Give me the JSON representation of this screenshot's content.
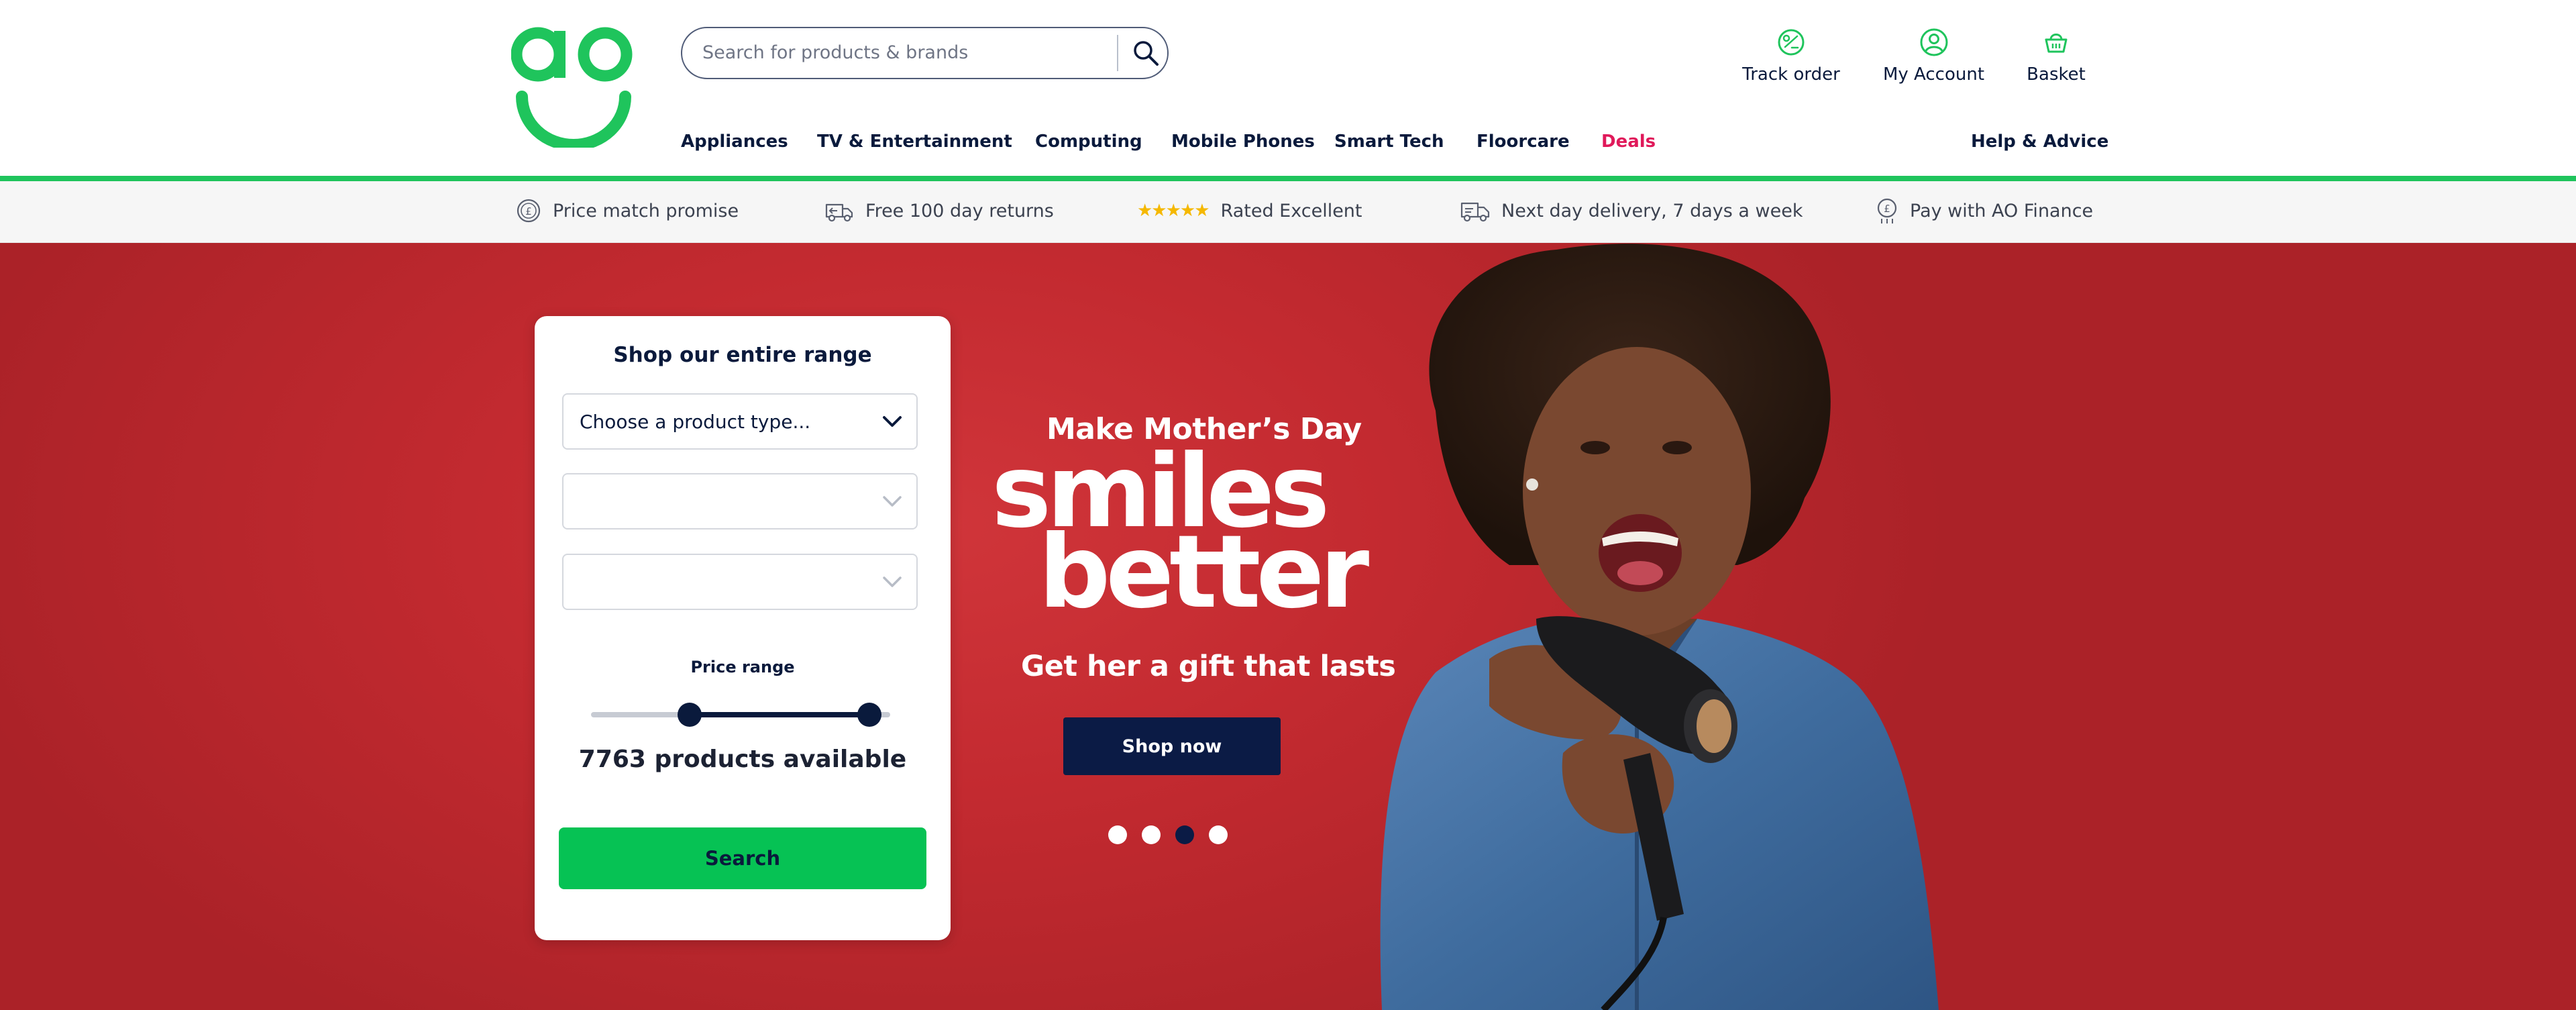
{
  "colors": {
    "brand_green": "#1fc45c",
    "navy": "#0a1a3c",
    "deals_pink": "#e0195a",
    "hero_red": "#c32a30",
    "search_button_green": "#06c254"
  },
  "header": {
    "search": {
      "placeholder": "Search for products & brands",
      "icon": "search-icon"
    },
    "utility": [
      {
        "label": "Track order",
        "icon": "track-order-icon"
      },
      {
        "label": "My Account",
        "icon": "account-icon"
      },
      {
        "label": "Basket",
        "icon": "basket-icon"
      }
    ],
    "nav": [
      "Appliances",
      "TV & Entertainment",
      "Computing",
      "Mobile Phones",
      "Smart Tech",
      "Floorcare",
      "Deals",
      "Help & Advice"
    ]
  },
  "usp_bar": [
    {
      "text": "Price match promise",
      "icon": "pound-coin-icon"
    },
    {
      "text": "Free 100 day returns",
      "icon": "returns-van-icon"
    },
    {
      "text": "Rated Excellent",
      "icon": "five-stars-icon"
    },
    {
      "text": "Next day delivery, 7 days a week",
      "icon": "delivery-truck-icon"
    },
    {
      "text": "Pay with AO Finance",
      "icon": "finance-icon"
    }
  ],
  "finder": {
    "title": "Shop our entire range",
    "product_type_placeholder": "Choose a product type...",
    "price_label": "Price range",
    "price_range_selected_fraction": [
      0.33,
      0.93
    ],
    "count_text": "7763 products available",
    "search_label": "Search"
  },
  "promo": {
    "kicker": "Make Mother’s Day",
    "headline_1": "smiles",
    "headline_2": "better",
    "subline": "Get her a gift that lasts",
    "cta": "Shop now",
    "carousel_slides": 4,
    "carousel_active": 3
  }
}
